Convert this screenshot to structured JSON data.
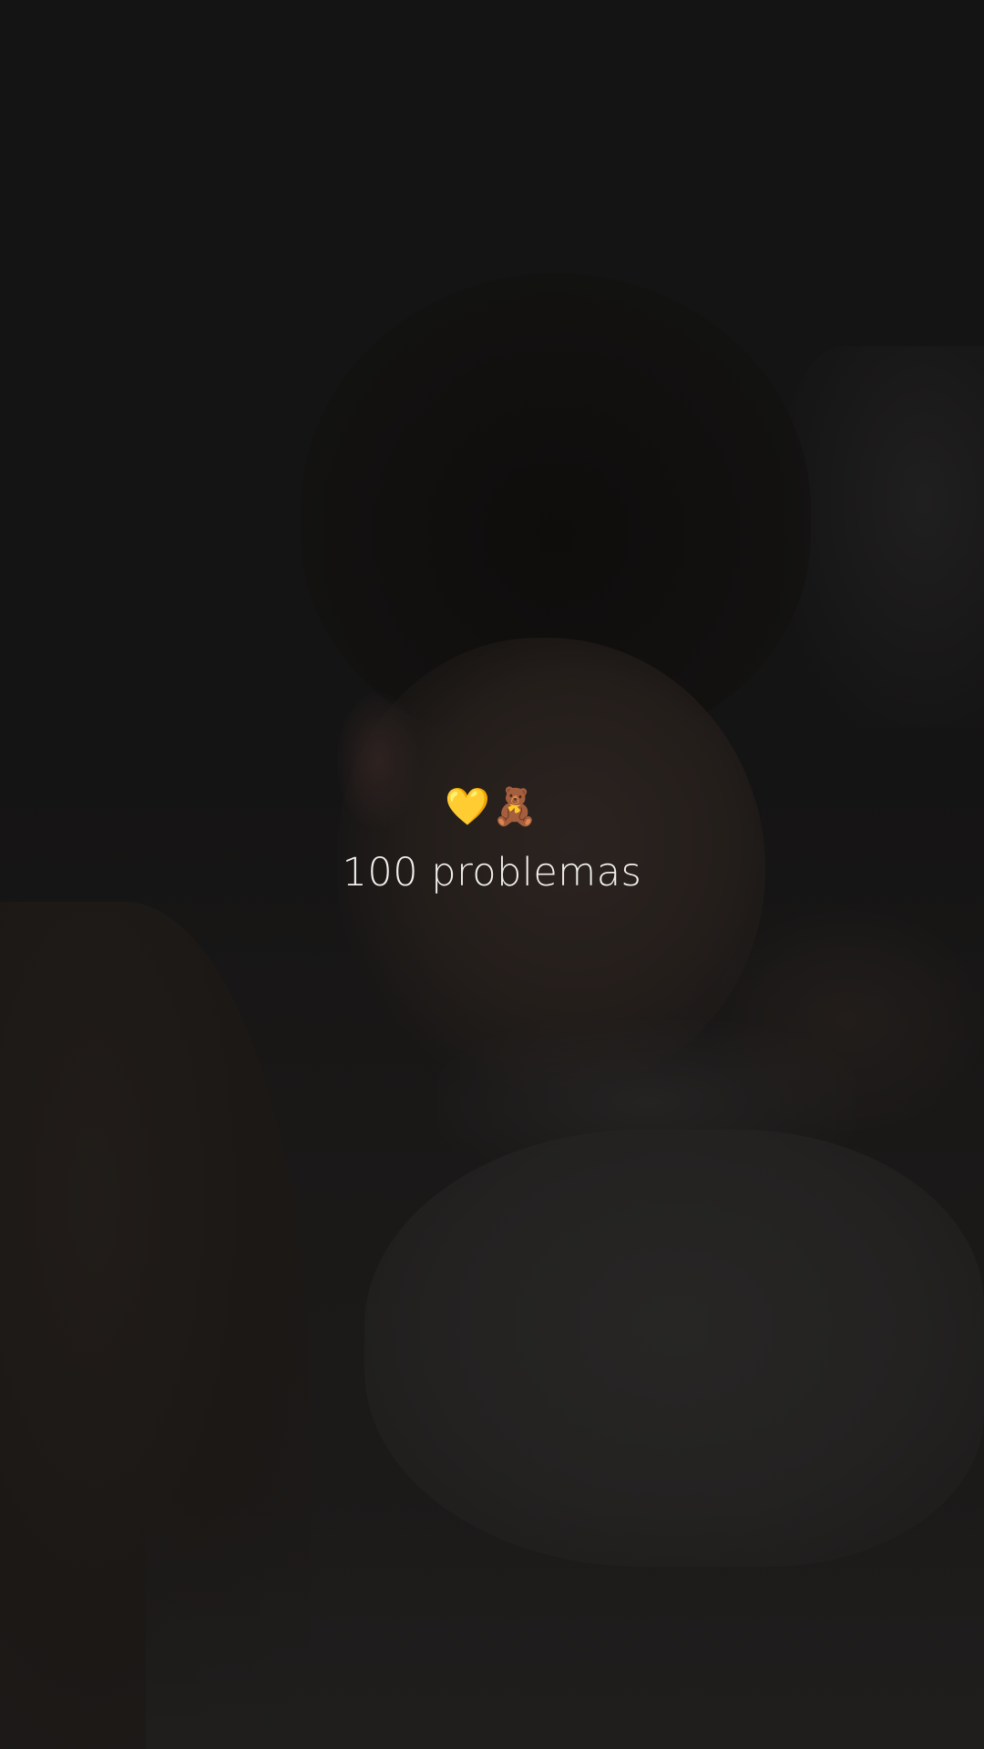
{
  "story": {
    "emoji_line": "💛🧸",
    "caption": "100 problemas"
  },
  "colors": {
    "background": "#151413",
    "caption_text": "#f2f0ec"
  }
}
